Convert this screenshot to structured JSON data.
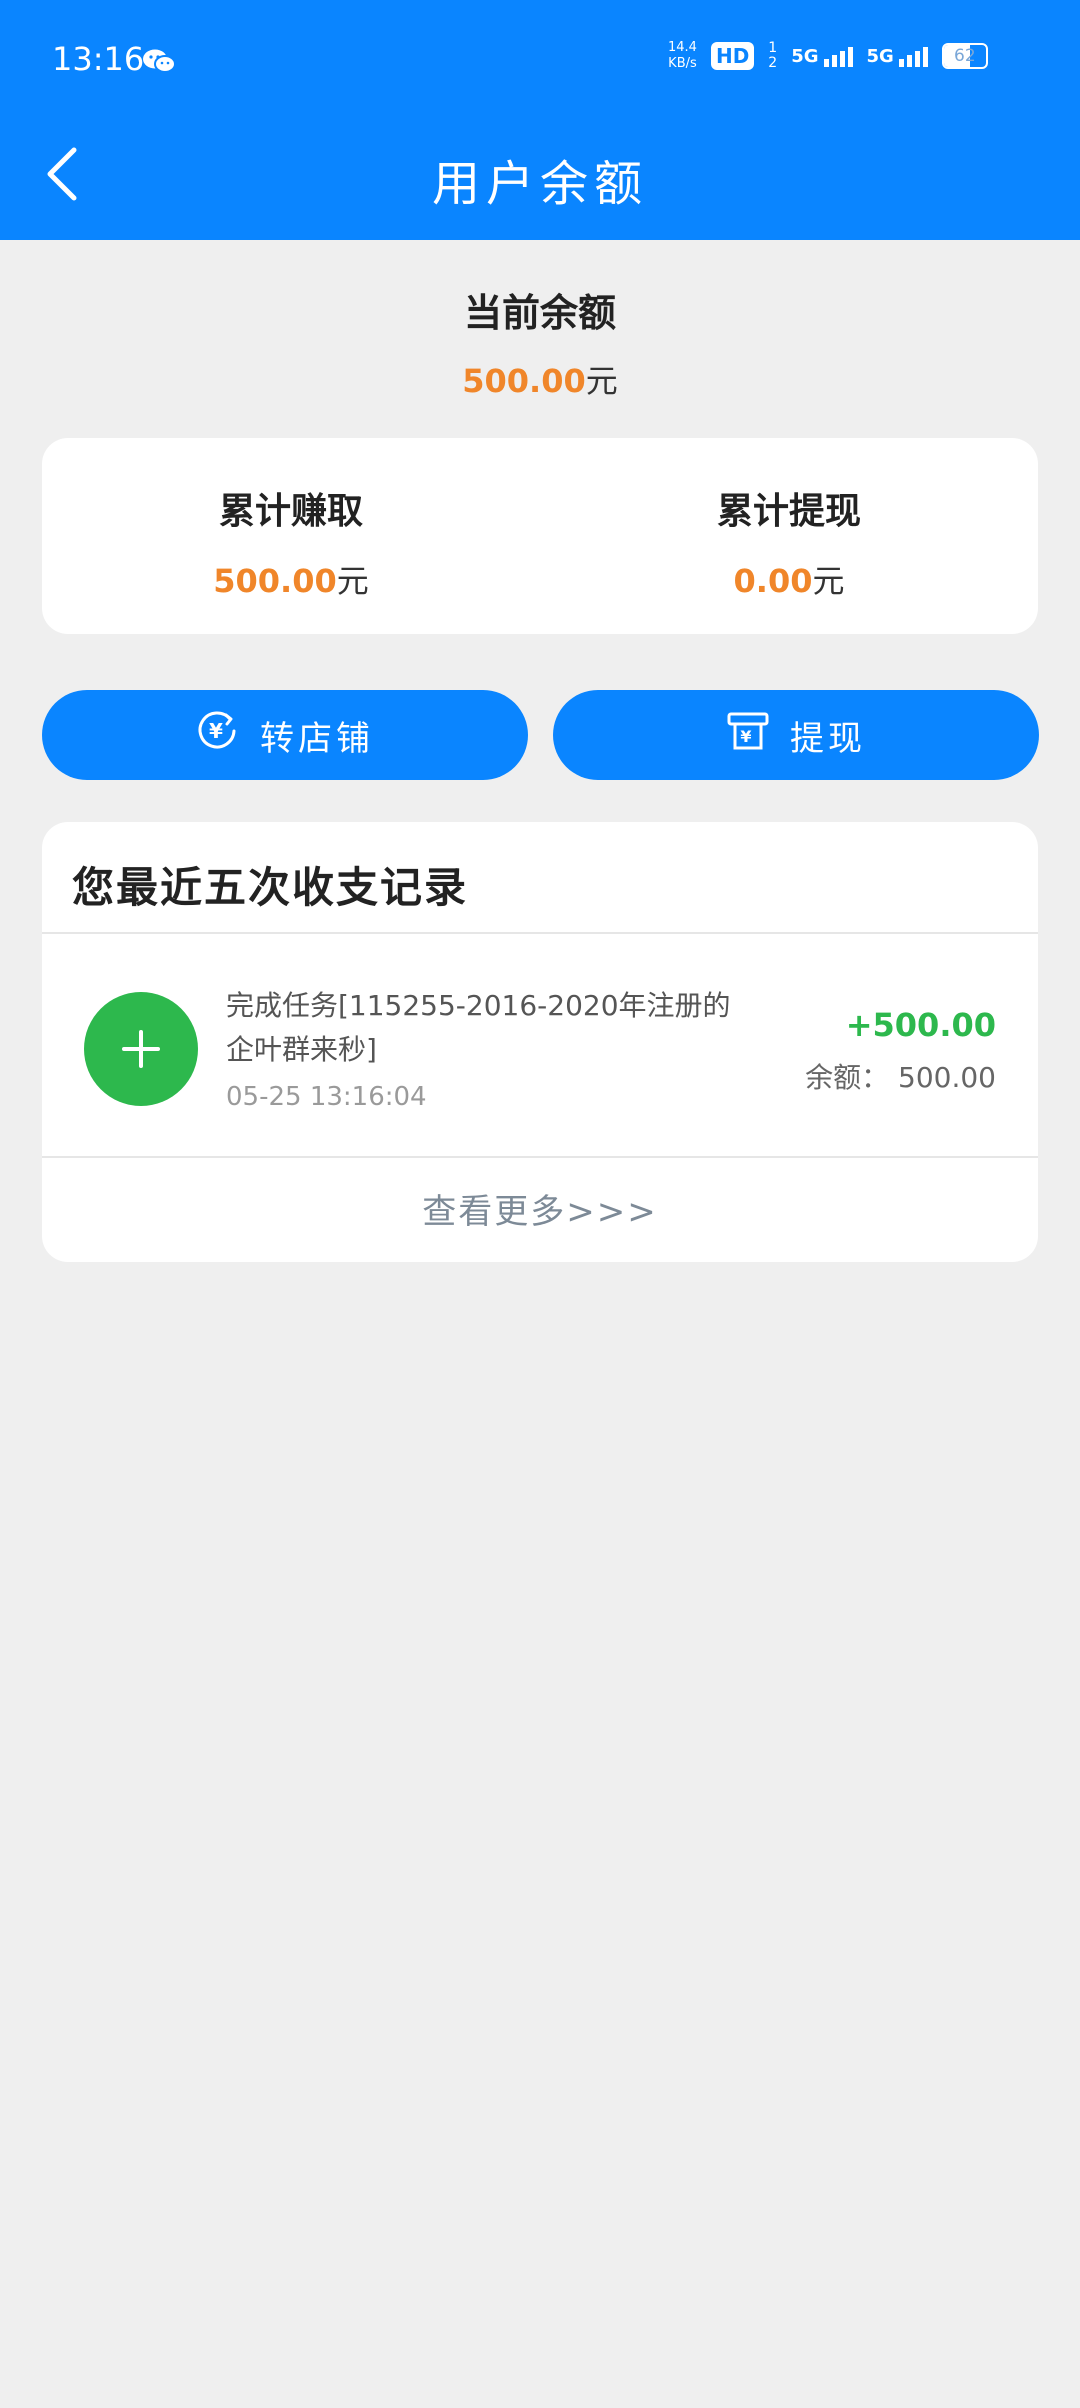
{
  "status_bar": {
    "time": "13:16",
    "net_speed": "14.4",
    "net_speed_unit": "KB/s",
    "hd_badge": "HD",
    "sim_sub_top": "1",
    "sim_sub_bottom": "2",
    "network_1": "5G",
    "network_2": "5G",
    "battery": "62"
  },
  "header": {
    "title": "用户余额"
  },
  "balance": {
    "label": "当前余额",
    "amount": "500.00",
    "unit": "元"
  },
  "stats": {
    "earned_label": "累计赚取",
    "earned_amount": "500.00",
    "earned_unit": "元",
    "withdrawn_label": "累计提现",
    "withdrawn_amount": "0.00",
    "withdrawn_unit": "元"
  },
  "actions": {
    "transfer_label": "转店铺",
    "withdraw_label": "提现"
  },
  "records": {
    "title": "您最近五次收支记录",
    "items": [
      {
        "description": "完成任务[115255-2016-2020年注册的企叶群来秒]",
        "time": "05-25  13:16:04",
        "amount": "+500.00",
        "balance_text": "余额： 500.00"
      }
    ],
    "view_more": "查看更多>>>"
  },
  "colors": {
    "primary": "#0a85ff",
    "amount_orange": "#f0862a",
    "income_green": "#2db84d",
    "background": "#efefef"
  }
}
